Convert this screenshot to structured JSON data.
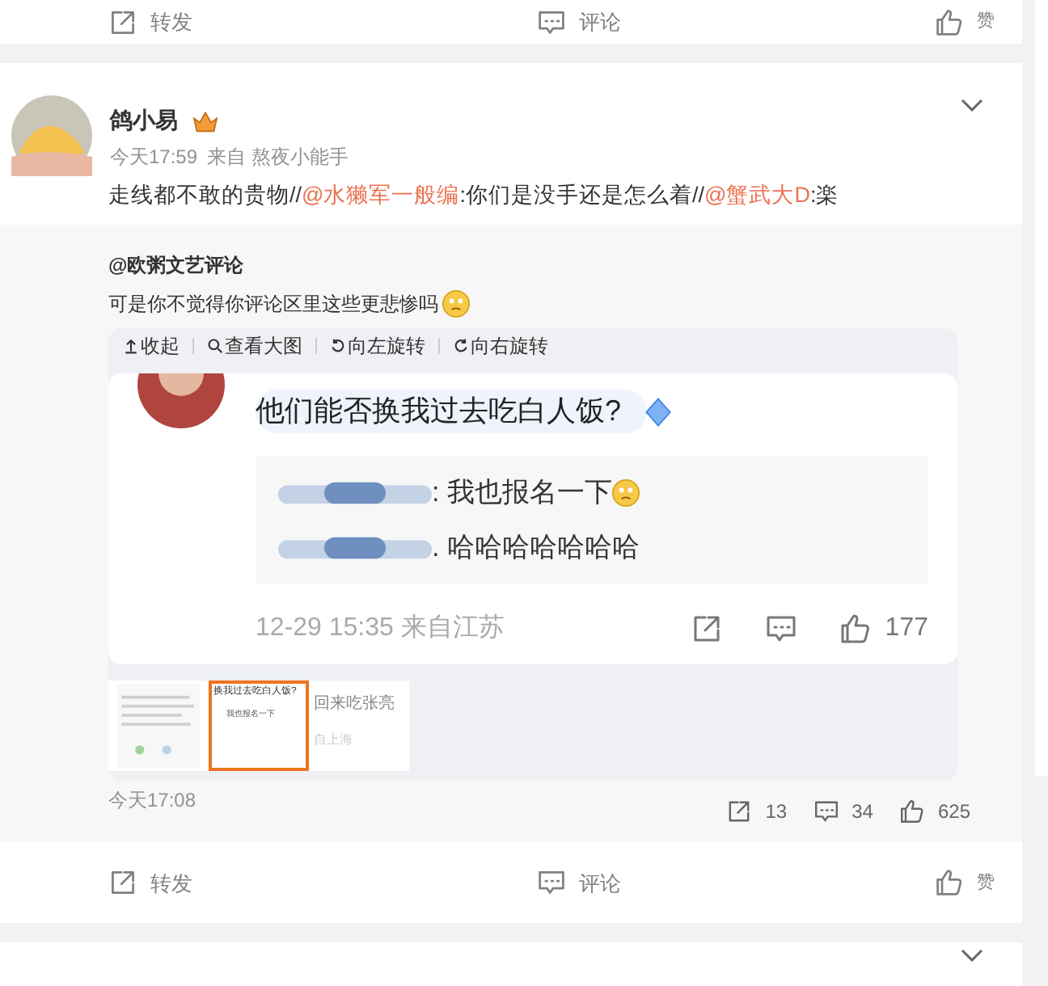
{
  "top_card": {
    "actions": [
      {
        "kind": "repost",
        "label": "转发"
      },
      {
        "kind": "comment",
        "label": "评论"
      },
      {
        "kind": "like",
        "label": "赞"
      }
    ]
  },
  "post": {
    "author": "鸽小易",
    "time": "今天17:59",
    "source": "来自 熬夜小能手",
    "text": [
      {
        "kind": "plain",
        "text": "走线都不敢的贵物//"
      },
      {
        "kind": "mention",
        "text": "@水獭军一般编"
      },
      {
        "kind": "plain",
        "text": ":你们是没手还是怎么着//"
      },
      {
        "kind": "mention",
        "text": "@蟹武大D"
      },
      {
        "kind": "plain",
        "text": ":楽"
      }
    ],
    "repost": {
      "author": "@欧粥文艺评论",
      "text": "可是你不觉得你评论区里这些更悲惨吗",
      "toolbar": [
        {
          "kind": "collapse",
          "label": "收起"
        },
        {
          "kind": "zoom",
          "label": "查看大图"
        },
        {
          "kind": "rotate_left",
          "label": "向左旋转"
        },
        {
          "kind": "rotate_right",
          "label": "向右旋转"
        }
      ],
      "image": {
        "comment": "他们能否换我过去吃白人饭?",
        "replies": [
          {
            "text": ": 我也报名一下",
            "emoji": true
          },
          {
            "text": ". 哈哈哈哈哈哈哈",
            "emoji": false
          }
        ],
        "meta": "12-29 15:35 来自江苏",
        "likes": "177"
      },
      "thumbnails": [
        {
          "kind": "picture",
          "selected": false
        },
        {
          "kind": "comment",
          "selected": true,
          "title": "换我过去吃白人饭?",
          "line": "我也报名一下"
        },
        {
          "kind": "comment",
          "selected": false,
          "title": "回来吃张亮",
          "line": "自上海"
        }
      ],
      "time": "今天17:08",
      "counts": [
        {
          "kind": "repost",
          "value": "13"
        },
        {
          "kind": "comment",
          "value": "34"
        },
        {
          "kind": "like",
          "value": "625"
        }
      ]
    },
    "actions": [
      {
        "kind": "repost",
        "label": "转发"
      },
      {
        "kind": "comment",
        "label": "评论"
      },
      {
        "kind": "like",
        "label": "赞"
      }
    ]
  }
}
